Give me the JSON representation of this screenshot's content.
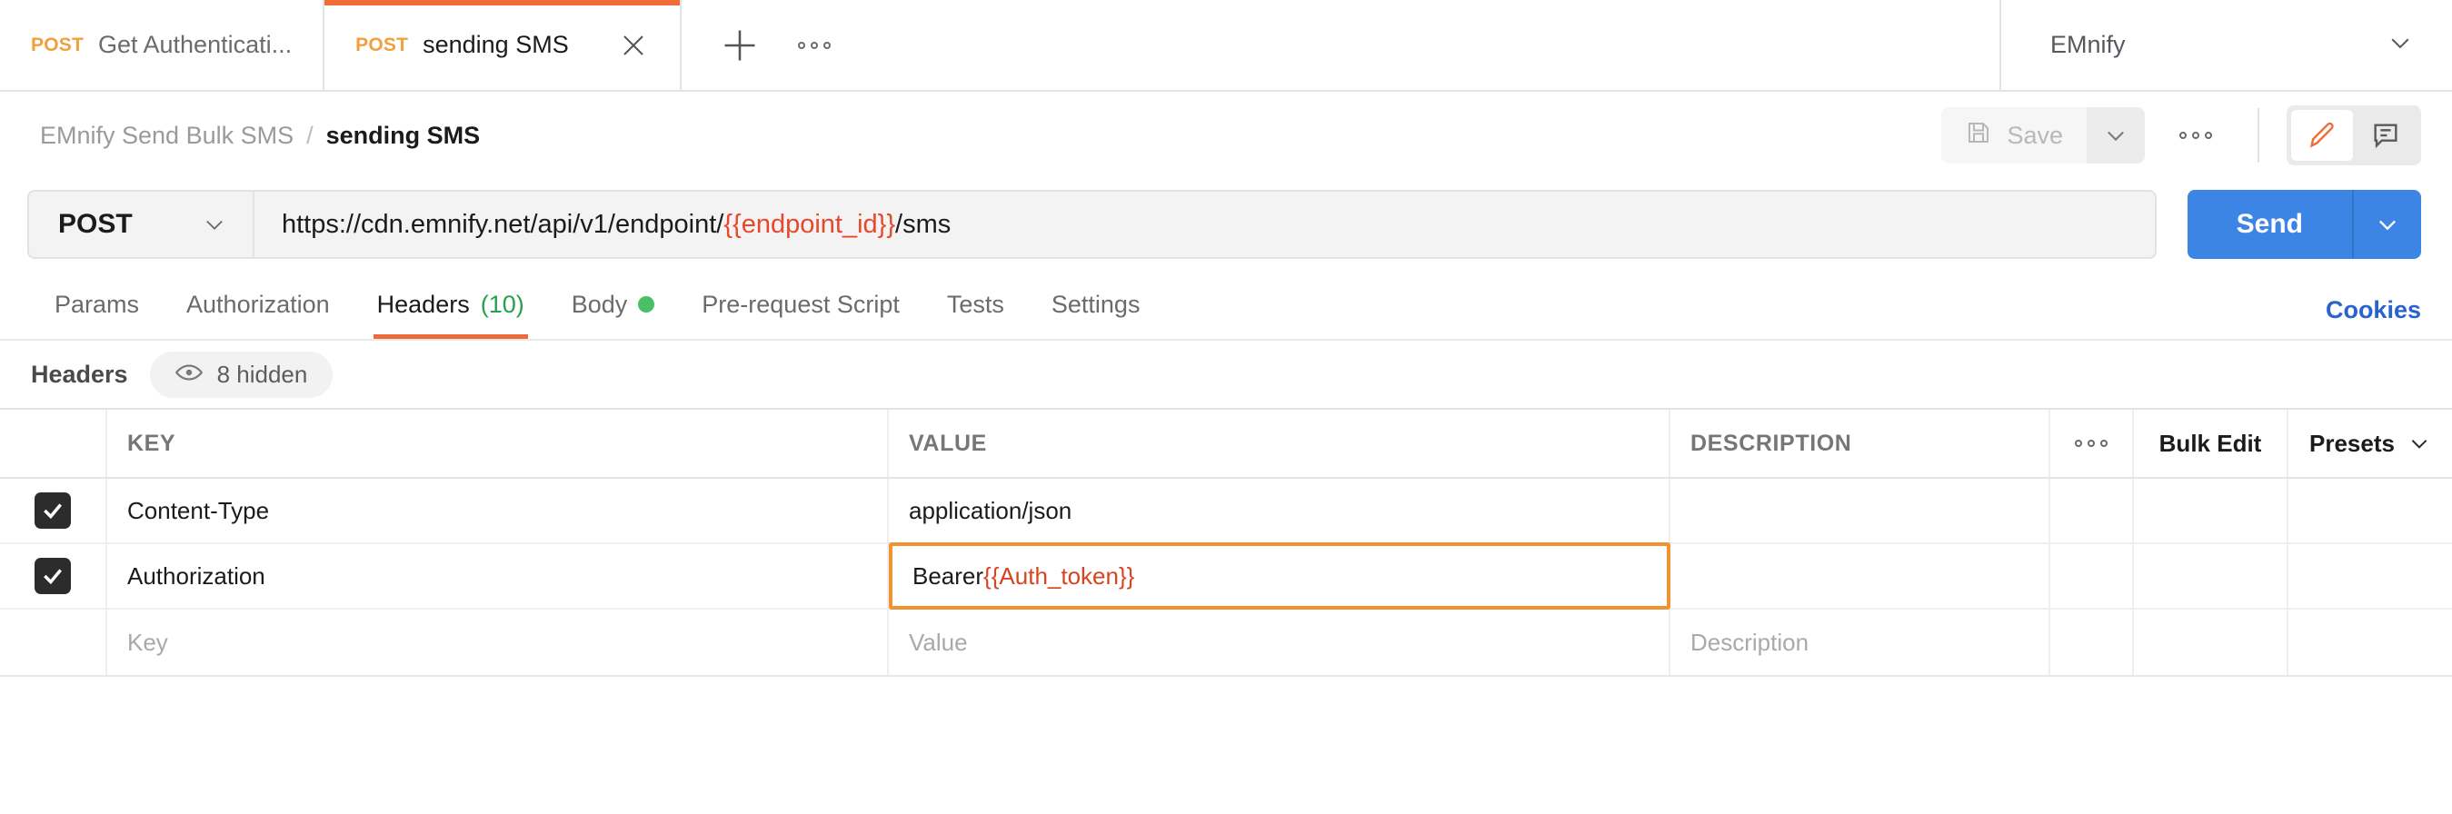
{
  "tabbar": {
    "tabs": [
      {
        "method": "POST",
        "label": "Get Authenticati...",
        "active": false
      },
      {
        "method": "POST",
        "label": "sending SMS",
        "active": true
      }
    ],
    "new_tab_icon": "plus-icon",
    "more_icon": "more-horizontal-icon",
    "environment": {
      "name": "EMnify",
      "caret_icon": "chevron-down-icon"
    }
  },
  "breadcrumb": {
    "collection": "EMnify Send Bulk SMS",
    "separator": "/",
    "current": "sending SMS"
  },
  "actions": {
    "save_label": "Save",
    "save_icon": "floppy-disk-icon",
    "save_caret_icon": "chevron-down-icon",
    "more_icon": "more-horizontal-icon",
    "edit_icon": "pencil-icon",
    "comment_icon": "comment-icon"
  },
  "request": {
    "method": "POST",
    "method_caret_icon": "chevron-down-icon",
    "url_prefix": "https://cdn.emnify.net/api/v1/endpoint/",
    "url_variable": "{{endpoint_id}}",
    "url_suffix": "/sms",
    "send_label": "Send",
    "send_caret_icon": "chevron-down-icon"
  },
  "request_tabs": [
    {
      "label": "Params",
      "active": false,
      "count": "",
      "dot": false
    },
    {
      "label": "Authorization",
      "active": false,
      "count": "",
      "dot": false
    },
    {
      "label": "Headers",
      "active": true,
      "count": "(10)",
      "dot": false
    },
    {
      "label": "Body",
      "active": false,
      "count": "",
      "dot": true
    },
    {
      "label": "Pre-request Script",
      "active": false,
      "count": "",
      "dot": false
    },
    {
      "label": "Tests",
      "active": false,
      "count": "",
      "dot": false
    },
    {
      "label": "Settings",
      "active": false,
      "count": "",
      "dot": false
    }
  ],
  "cookies_label": "Cookies",
  "headers_section": {
    "title": "Headers",
    "hidden_icon": "eye-icon",
    "hidden_label": "8 hidden"
  },
  "table": {
    "columns": {
      "key": "KEY",
      "value": "VALUE",
      "description": "DESCRIPTION"
    },
    "toolbar": {
      "more_icon": "more-horizontal-icon",
      "bulk_edit": "Bulk Edit",
      "presets": "Presets",
      "presets_caret_icon": "chevron-down-icon"
    },
    "rows": [
      {
        "checked": true,
        "key": "Content-Type",
        "value": "application/json",
        "description": "",
        "value_focused": false
      },
      {
        "checked": true,
        "key": "Authorization",
        "value_plain": "Bearer ",
        "value_variable": "{{Auth_token}}",
        "description": "",
        "value_focused": true
      }
    ],
    "new_row": {
      "key_placeholder": "Key",
      "value_placeholder": "Value",
      "description_placeholder": "Description"
    }
  },
  "colors": {
    "accent_orange": "#ef6c36",
    "method_orange": "#f0a03c",
    "send_blue": "#3d85e4",
    "link_blue": "#2a62cf",
    "variable_red": "#e8472b",
    "green": "#4bbf63",
    "count_green": "#25a14f",
    "focus_border": "#ef9431"
  }
}
